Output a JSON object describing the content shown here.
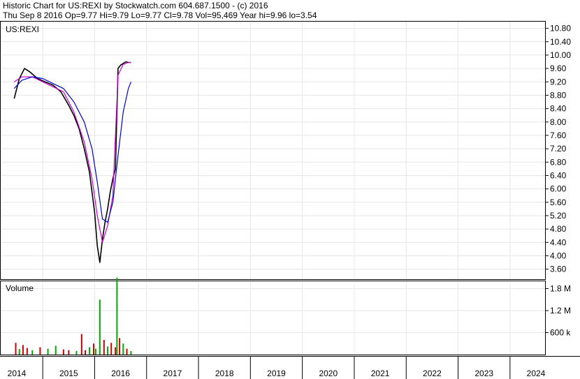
{
  "header": {
    "line1": "Historic Chart for US:REXI by Stockwatch.com 604.687.1500 - (c) 2016",
    "line2": "Thu Sep  8 2016  Op=9.77  Hi=9.79  Lo=9.77  Cl=9.78  Vol=95,469  Year hi=9.96  lo=3.54"
  },
  "chart_data": [
    {
      "type": "line",
      "title": "US:REXI",
      "ylim": [
        3.3,
        11.0
      ],
      "y_ticks": [
        "10.80",
        "10.40",
        "10.00",
        "9.60",
        "9.20",
        "8.80",
        "8.40",
        "8.00",
        "7.60",
        "7.20",
        "6.80",
        "6.40",
        "6.00",
        "5.60",
        "5.20",
        "4.80",
        "4.40",
        "4.00",
        "3.60"
      ],
      "x_labels": [
        "2014",
        "2015",
        "2016",
        "2017",
        "2018",
        "2019",
        "2020",
        "2021",
        "2022",
        "2023",
        "2024"
      ],
      "grid": true,
      "colors": {
        "price": "#000000",
        "ma_short": "#cc00cc",
        "ma_long": "#0000cc"
      },
      "series": [
        {
          "key": "price",
          "x": [
            2013.95,
            2014.05,
            2014.15,
            2014.25,
            2014.4,
            2014.55,
            2014.7,
            2014.85,
            2015.0,
            2015.1,
            2015.2,
            2015.3,
            2015.4,
            2015.45,
            2015.5,
            2015.55,
            2015.6,
            2015.65,
            2015.7,
            2015.75,
            2015.8,
            2015.85,
            2015.9,
            2015.95,
            2016.0,
            2016.05,
            2016.1,
            2016.15,
            2016.2
          ],
          "y": [
            8.7,
            9.3,
            9.6,
            9.5,
            9.3,
            9.2,
            9.1,
            8.9,
            8.5,
            8.2,
            7.8,
            7.2,
            6.5,
            5.9,
            5.3,
            4.3,
            3.8,
            4.5,
            5.0,
            5.4,
            5.9,
            6.3,
            6.6,
            9.6,
            9.7,
            9.75,
            9.8,
            9.78,
            9.78
          ]
        },
        {
          "key": "ma_short",
          "x": [
            2013.95,
            2014.1,
            2014.3,
            2014.5,
            2014.7,
            2014.9,
            2015.1,
            2015.3,
            2015.45,
            2015.55,
            2015.65,
            2015.75,
            2015.85,
            2015.95,
            2016.05,
            2016.15,
            2016.2
          ],
          "y": [
            9.2,
            9.35,
            9.35,
            9.2,
            9.05,
            8.9,
            8.3,
            7.4,
            6.3,
            5.2,
            4.4,
            4.9,
            5.8,
            9.4,
            9.72,
            9.78,
            9.78
          ]
        },
        {
          "key": "ma_long",
          "x": [
            2013.95,
            2014.1,
            2014.3,
            2014.5,
            2014.7,
            2014.9,
            2015.1,
            2015.3,
            2015.45,
            2015.55,
            2015.65,
            2015.75,
            2015.85,
            2015.95,
            2016.05,
            2016.15,
            2016.2
          ],
          "y": [
            9.0,
            9.25,
            9.35,
            9.3,
            9.15,
            9.0,
            8.6,
            8.0,
            7.2,
            6.2,
            5.1,
            5.0,
            5.6,
            7.0,
            8.3,
            9.0,
            9.2
          ]
        }
      ]
    },
    {
      "type": "bar",
      "title": "Volume",
      "ylim": [
        0,
        2000000
      ],
      "y_ticks": [
        "1.8 M",
        "1.2 M",
        "600 k"
      ],
      "colors": {
        "up": "#00aa00",
        "down": "#cc0000"
      },
      "x": [
        2013.98,
        2014.05,
        2014.12,
        2014.2,
        2014.3,
        2014.45,
        2014.6,
        2014.75,
        2014.9,
        2015.0,
        2015.15,
        2015.25,
        2015.32,
        2015.4,
        2015.48,
        2015.52,
        2015.6,
        2015.68,
        2015.75,
        2015.82,
        2015.9,
        2015.93,
        2015.98,
        2016.05,
        2016.12,
        2016.2
      ],
      "values": [
        320000,
        150000,
        260000,
        180000,
        120000,
        200000,
        160000,
        240000,
        140000,
        120000,
        100000,
        560000,
        120000,
        200000,
        300000,
        160000,
        1500000,
        400000,
        220000,
        320000,
        200000,
        2100000,
        450000,
        300000,
        160000,
        95469
      ],
      "direction": [
        "down",
        "up",
        "down",
        "down",
        "up",
        "down",
        "up",
        "up",
        "down",
        "down",
        "up",
        "down",
        "down",
        "up",
        "down",
        "up",
        "up",
        "down",
        "up",
        "down",
        "down",
        "up",
        "down",
        "up",
        "down",
        "up"
      ]
    }
  ]
}
